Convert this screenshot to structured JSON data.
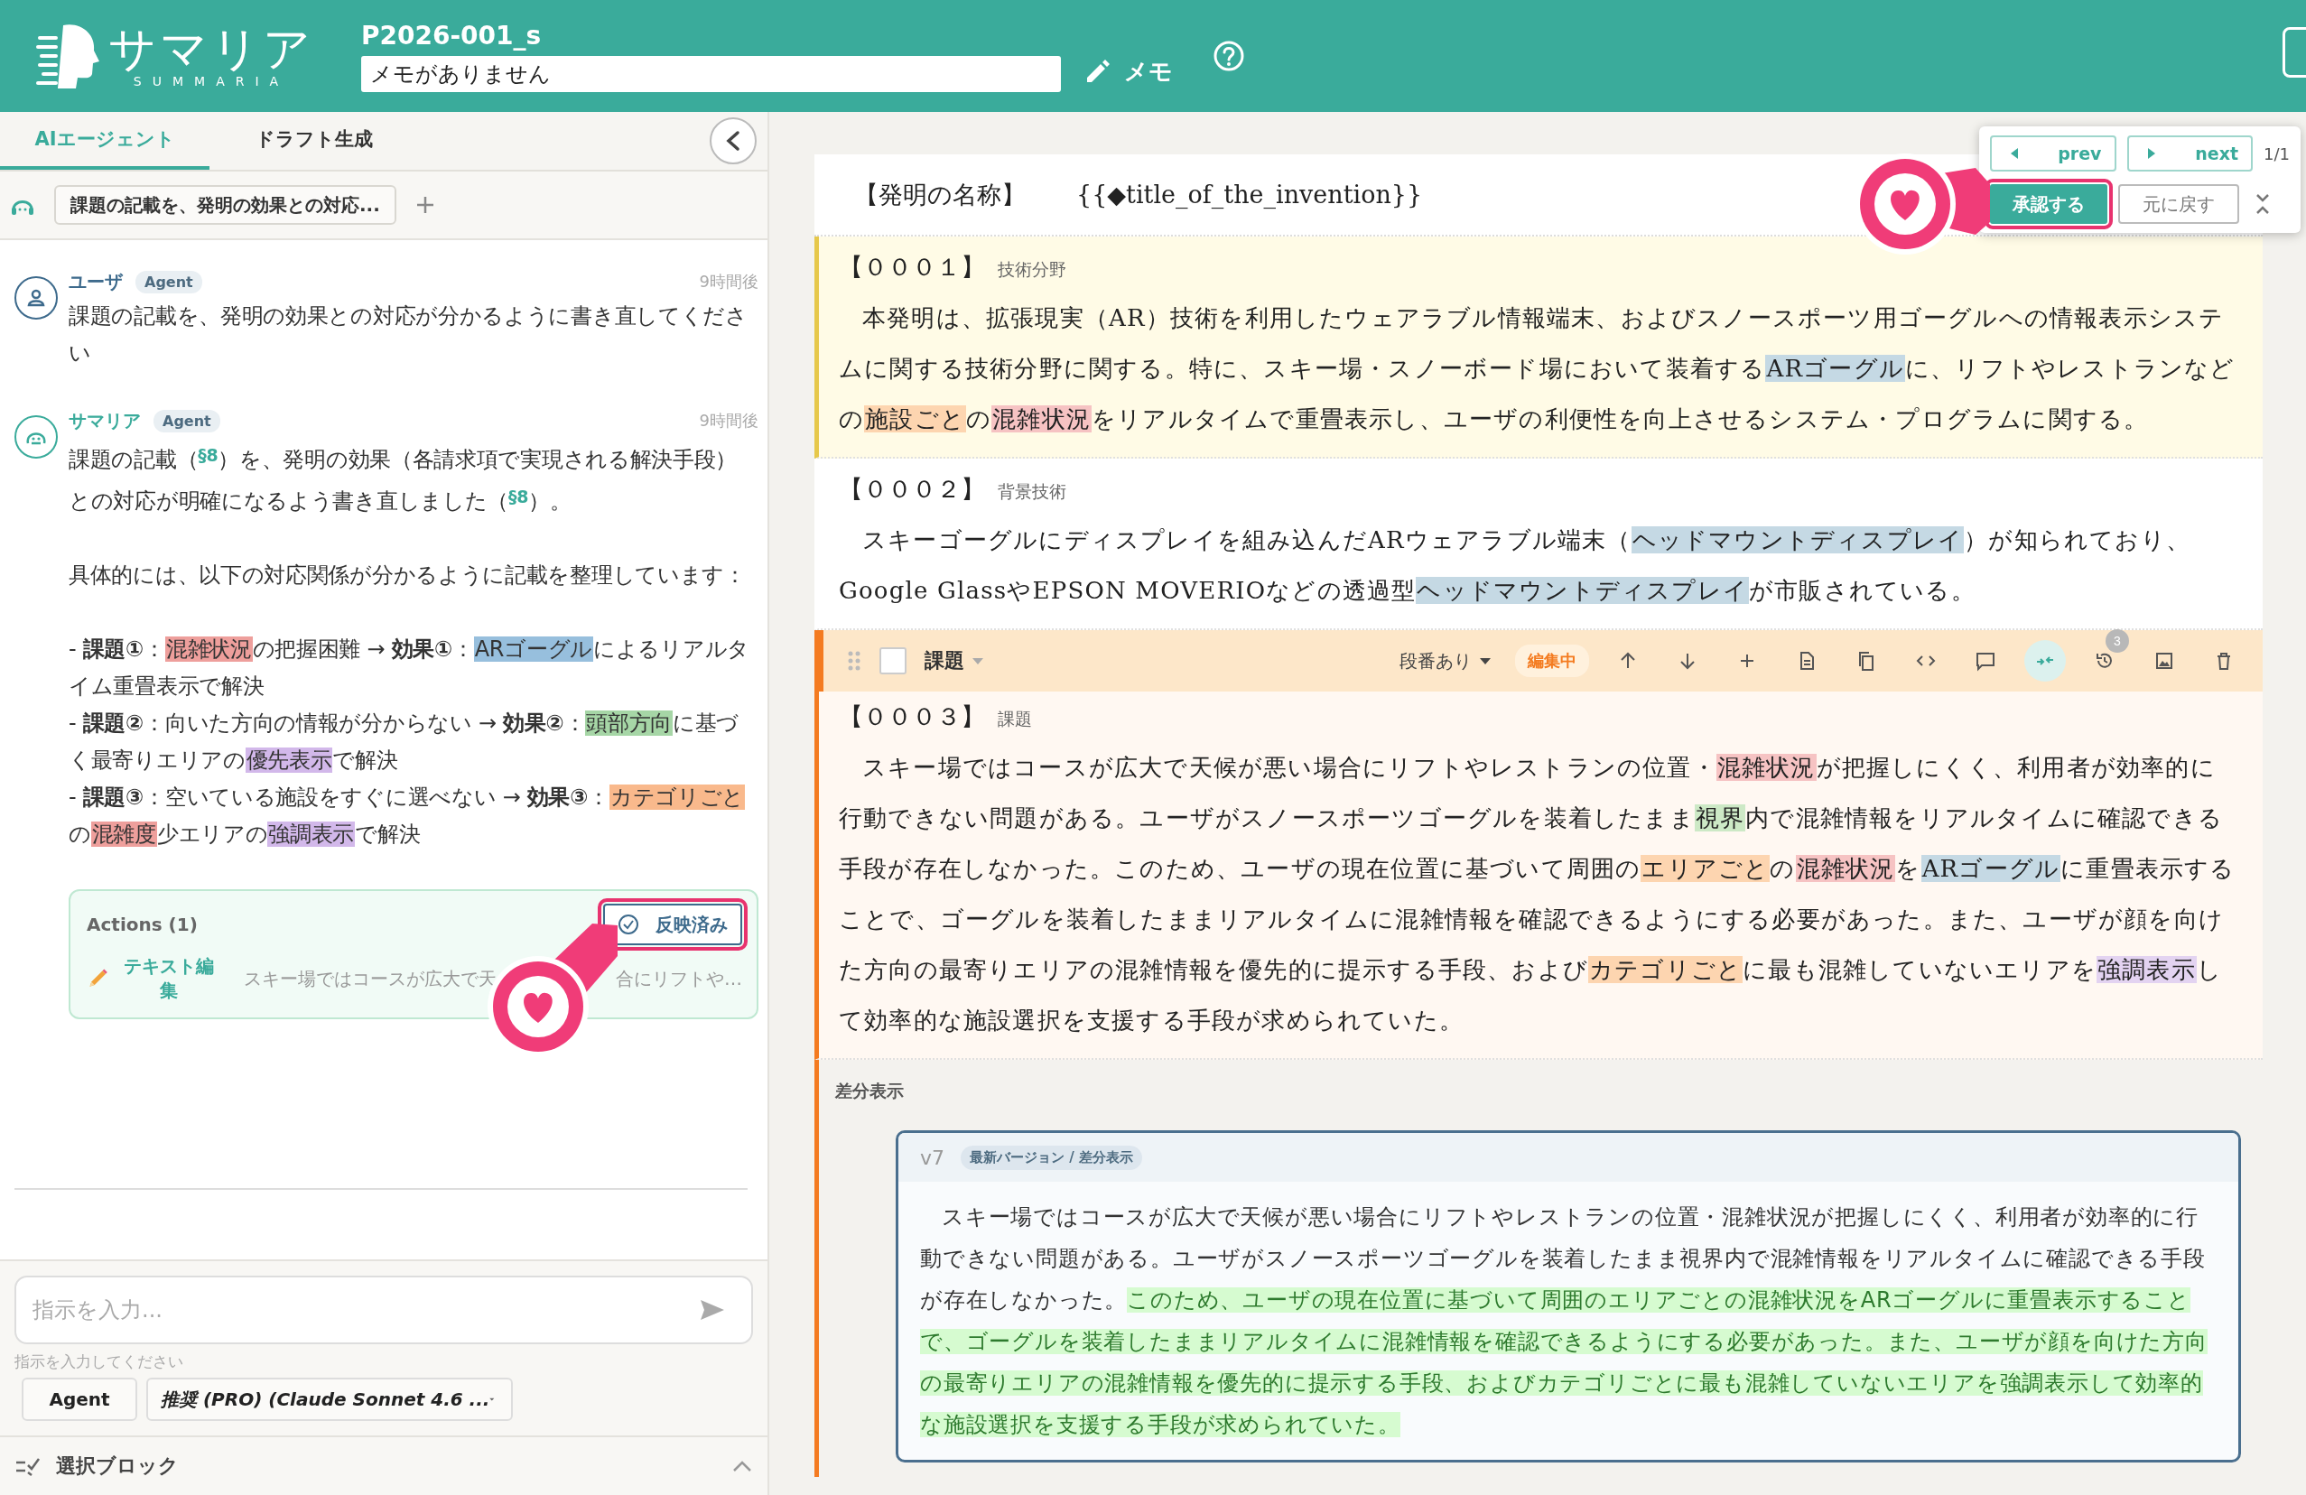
{
  "header": {
    "logo": {
      "title": "サマリア",
      "subtitle": "SUMMARIA"
    },
    "project": "P2026-001_s",
    "memo": {
      "value": "メモがありません"
    },
    "memo_button": "メモ"
  },
  "left_panel": {
    "tabs": [
      {
        "label": "AIエージェント",
        "selected": true
      },
      {
        "label": "ドラフト生成",
        "selected": false
      }
    ],
    "thread": {
      "title": "課題の記載を、発明の効果との対応..."
    },
    "messages": [
      {
        "kind": "user",
        "author": "ユーザ",
        "badge": "Agent",
        "time": "9時間後",
        "paragraphs": [
          {
            "kind": "text",
            "segments": [
              {
                "text": "課題の記載を、発明の効果との対応が分かるように書き直してください"
              }
            ]
          }
        ]
      },
      {
        "kind": "agent",
        "author": "サマリア",
        "badge": "Agent",
        "time": "9時間後",
        "paragraphs": [
          {
            "kind": "text",
            "segments": [
              {
                "text": "課題の記載（"
              },
              {
                "text": "§8",
                "kind": "ref"
              },
              {
                "text": "）を、発明の効果（各請求項で実現される解決手段）との対応が明確になるよう書き直しました（"
              },
              {
                "text": "§8",
                "kind": "ref"
              },
              {
                "text": "）。"
              }
            ]
          },
          {
            "kind": "text",
            "segments": [
              {
                "text": "具体的には、以下の対応関係が分かるように記載を整理しています："
              }
            ]
          },
          {
            "kind": "list_item",
            "segments": [
              {
                "text": "- **課題①**："
              },
              {
                "text": "混雑状況",
                "color": "#ee9f9c"
              },
              {
                "text": "の把握困難 → **効果①**："
              },
              {
                "text": "ARゴーグル",
                "color": "#97bfdd"
              },
              {
                "text": "によるリアルタイム重畳表示で解決"
              }
            ]
          },
          {
            "kind": "list_item",
            "segments": [
              {
                "text": "- **課題②**：向いた方向の情報が分からない → **効果②**："
              },
              {
                "text": "頭部方向",
                "color": "#a6d6a6"
              },
              {
                "text": "に基づく最寄りエリアの"
              },
              {
                "text": "優先表示",
                "color": "#d2b8ea"
              },
              {
                "text": "で解決"
              }
            ]
          },
          {
            "kind": "list_item",
            "segments": [
              {
                "text": "- **課題③**：空いている施設をすぐに選べない → **効果③**："
              },
              {
                "text": "カテゴリごと",
                "color": "#f9b98c"
              },
              {
                "text": "の"
              },
              {
                "text": "混雑度",
                "color": "#ee9f9c"
              },
              {
                "text": "少エリアの"
              },
              {
                "text": "強調表示",
                "color": "#d2b8ea"
              },
              {
                "text": "で解決"
              }
            ]
          }
        ],
        "actions": {
          "title": "Actions (1)",
          "status": {
            "label": "反映済み",
            "marked": true
          },
          "items": [
            {
              "label": "テキスト編集",
              "preview_parts": [
                "スキー場ではコースが広大で天",
                "合にリフトや…"
              ]
            }
          ]
        }
      }
    ],
    "input": {
      "placeholder": "指示を入力...",
      "hint": "指示を入力してください"
    },
    "mode_button": "Agent",
    "model": "推奨 (PRO) (Claude Sonnet 4.6 ...",
    "selection_section": {
      "label": "選択ブロック",
      "expanded": false
    }
  },
  "review_nav": {
    "prev": "prev",
    "next": "next",
    "position": "1/1",
    "approve": {
      "label": "承認する",
      "marked": true
    },
    "revert": "元に戻す"
  },
  "document": {
    "title_row": {
      "label": "【発明の名称】",
      "value": "{{◆title_of_the_invention}}"
    },
    "paragraphs": [
      {
        "kind": "pending",
        "number": "【０００１】",
        "section": "技術分野",
        "segments": [
          {
            "text": "本発明は、拡張現実（AR）技術を利用したウェアラブル情報端末、およびスノースポーツ用ゴーグルへの情報表示システムに関する技術分野に関する。特に、スキー場・スノーボード場において装着する"
          },
          {
            "text": "ARゴーグル",
            "color": "#c5d9e4"
          },
          {
            "text": "に、リフトやレストランなどの"
          },
          {
            "text": "施設ごと",
            "color": "#fdd5b0"
          },
          {
            "text": "の"
          },
          {
            "text": "混雑状況",
            "color": "#f6c3c3"
          },
          {
            "text": "をリアルタイムで重畳表示し、ユーザの利便性を向上させるシステム・プログラムに関する。"
          }
        ]
      },
      {
        "kind": "plain",
        "number": "【０００２】",
        "section": "背景技術",
        "segments": [
          {
            "text": "スキーゴーグルにディスプレイを組み込んだARウェアラブル端末（"
          },
          {
            "text": "ヘッドマウントディスプレイ",
            "color": "#c5d9e4"
          },
          {
            "text": "）が知られており、Google GlassやEPSON MOVERIOなどの透過型"
          },
          {
            "text": "ヘッドマウントディスプレイ",
            "color": "#c5d9e4"
          },
          {
            "text": "が市販されている。"
          }
        ]
      },
      {
        "kind": "editing",
        "number": "【０００３】",
        "section": "課題",
        "toolbar": {
          "type": "課題",
          "checked": false,
          "numbering": "段番あり",
          "status": "編集中",
          "toggle_selected": true,
          "history_count": "3"
        },
        "segments": [
          {
            "text": "スキー場ではコースが広大で天候が悪い場合にリフトやレストランの位置・"
          },
          {
            "text": "混雑状況",
            "color": "#f6c3c3"
          },
          {
            "text": "が把握しにくく、利用者が効率的に行動できない問題がある。ユーザがスノースポーツゴーグルを装着したまま"
          },
          {
            "text": "視界",
            "color": "#cde9c6"
          },
          {
            "text": "内で混雑情報をリアルタイムに確認できる手段が存在しなかった。このため、ユーザの現在位置に基づいて周囲の"
          },
          {
            "text": "エリアごと",
            "color": "#fdd5b0"
          },
          {
            "text": "の"
          },
          {
            "text": "混雑状況",
            "color": "#f6c3c3"
          },
          {
            "text": "を"
          },
          {
            "text": "ARゴーグル",
            "color": "#c5d9e4"
          },
          {
            "text": "に重畳表示することで、ゴーグルを装着したままリアルタイムに混雑情報を確認できるようにする必要があった。また、ユーザが顔を向けた方向の最寄りエリアの混雑情報を優先的に提示する手段、および"
          },
          {
            "text": "カテゴリごと",
            "color": "#fdd5b0"
          },
          {
            "text": "に最も混雑していないエリアを"
          },
          {
            "text": "強調表示",
            "color": "#e3d3f1"
          },
          {
            "text": "して効率的な施設選択を支援する手段が求められていた。"
          }
        ]
      }
    ],
    "diff": {
      "label": "差分表示",
      "version": "v7",
      "badge": "最新バージョン / 差分表示",
      "segments": [
        {
          "text": "スキー場ではコースが広大で天候が悪い場合にリフトやレストランの位置・混雑状況が把握しにくく、利用者が効率的に行動できない問題がある。ユーザがスノースポーツゴーグルを装着したまま視界内で混雑情報をリアルタイムに確認できる手段が存在しなかった。",
          "added": false
        },
        {
          "text": "このため、ユーザの現在位置に基づいて周囲のエリアごとの混雑状況をARゴーグルに重畳表示することで、ゴーグルを装着したままリアルタイムに混雑情報を確認できるようにする必要があった。また、ユーザが顔を向けた方向の最寄りエリアの混雑情報を優先的に提示する手段、およびカテゴリごとに最も混雑していないエリアを強調表示して効率的な施設選択を支援する手段が求められていた。",
          "added": true
        }
      ]
    }
  }
}
